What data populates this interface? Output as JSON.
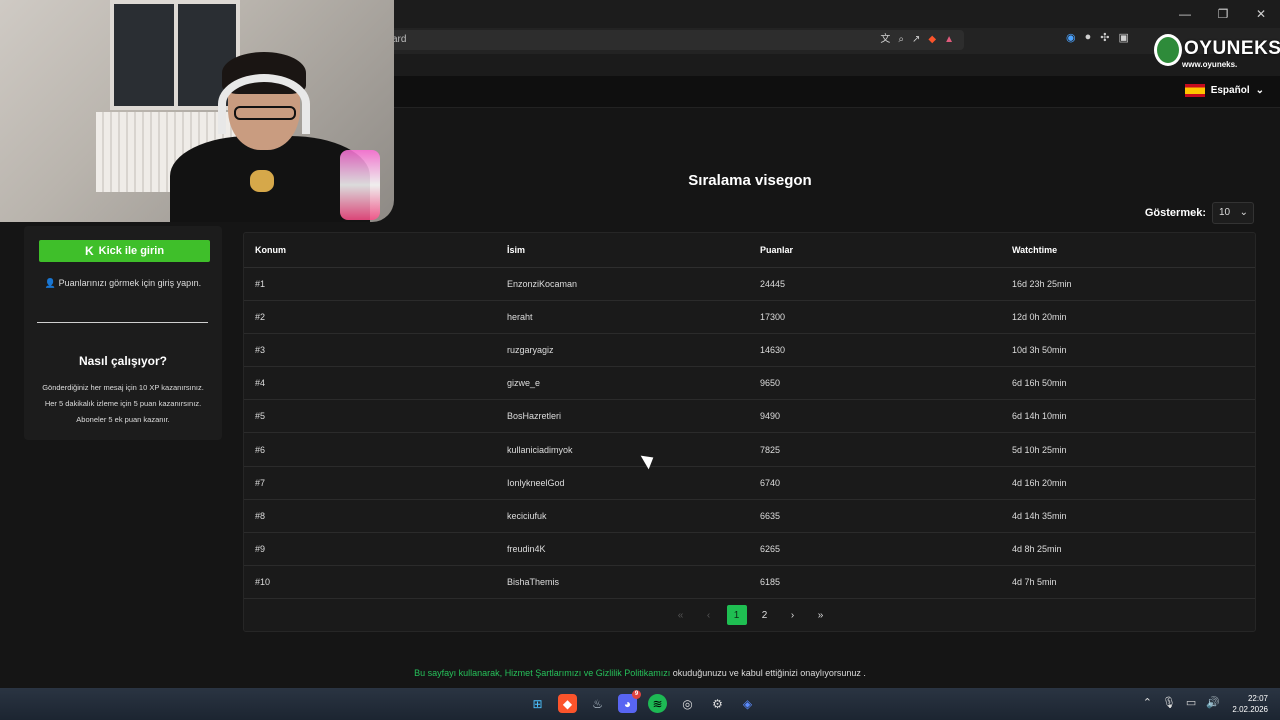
{
  "browser": {
    "url_fragment": "ard",
    "window_controls": [
      "—",
      "❐",
      "✕"
    ]
  },
  "watermark": {
    "brand": "OYUNEKS",
    "url": "www.oyuneks."
  },
  "site_header": {
    "language": "Español"
  },
  "leaderboard": {
    "title": "Sıralama visegon",
    "show_label": "Göstermek:",
    "page_size": "10",
    "columns": [
      "Konum",
      "İsim",
      "Puanlar",
      "Watchtime"
    ],
    "rows": [
      {
        "rank": "#1",
        "name": "EnzonziKocaman",
        "points": "24445",
        "watchtime": "16d 23h 25min"
      },
      {
        "rank": "#2",
        "name": "heraht",
        "points": "17300",
        "watchtime": "12d 0h 20min"
      },
      {
        "rank": "#3",
        "name": "ruzgaryagiz",
        "points": "14630",
        "watchtime": "10d 3h 50min"
      },
      {
        "rank": "#4",
        "name": "gizwe_e",
        "points": "9650",
        "watchtime": "6d 16h 50min"
      },
      {
        "rank": "#5",
        "name": "BosHazretleri",
        "points": "9490",
        "watchtime": "6d 14h 10min"
      },
      {
        "rank": "#6",
        "name": "kullaniciadimyok",
        "points": "7825",
        "watchtime": "5d 10h 25min"
      },
      {
        "rank": "#7",
        "name": "IonlykneelGod",
        "points": "6740",
        "watchtime": "4d 16h 20min"
      },
      {
        "rank": "#8",
        "name": "keciciufuk",
        "points": "6635",
        "watchtime": "4d 14h 35min"
      },
      {
        "rank": "#9",
        "name": "freudin4K",
        "points": "6265",
        "watchtime": "4d 8h 25min"
      },
      {
        "rank": "#10",
        "name": "BishaThemis",
        "points": "6185",
        "watchtime": "4d 7h 5min"
      }
    ],
    "pagination": {
      "first": "«",
      "prev": "‹",
      "pages": [
        "1",
        "2"
      ],
      "current": "1",
      "next": "›",
      "last": "»"
    }
  },
  "sidebar": {
    "kick_button": "Kick ile girin",
    "login_hint": "Puanlarınızı görmek için giriş yapın.",
    "how_title": "Nasıl çalışıyor?",
    "how_lines": [
      "Gönderdiğiniz her mesaj için 10 XP kazanırsınız.",
      "Her 5 dakikalık izleme için 5 puan kazanırsınız.",
      "Aboneler 5 ek puan kazanır."
    ]
  },
  "footer": {
    "prefix": "Bu sayfayı kullanarak, ",
    "terms_link": "Hizmet Şartlarımızı ve Gizlilik Politikamızı",
    "suffix": " okuduğunuzu ve kabul ettiğinizi onaylıyorsunuz ."
  },
  "taskbar": {
    "time": "22:07",
    "date": "2.02.2026",
    "discord_badge": "9"
  }
}
